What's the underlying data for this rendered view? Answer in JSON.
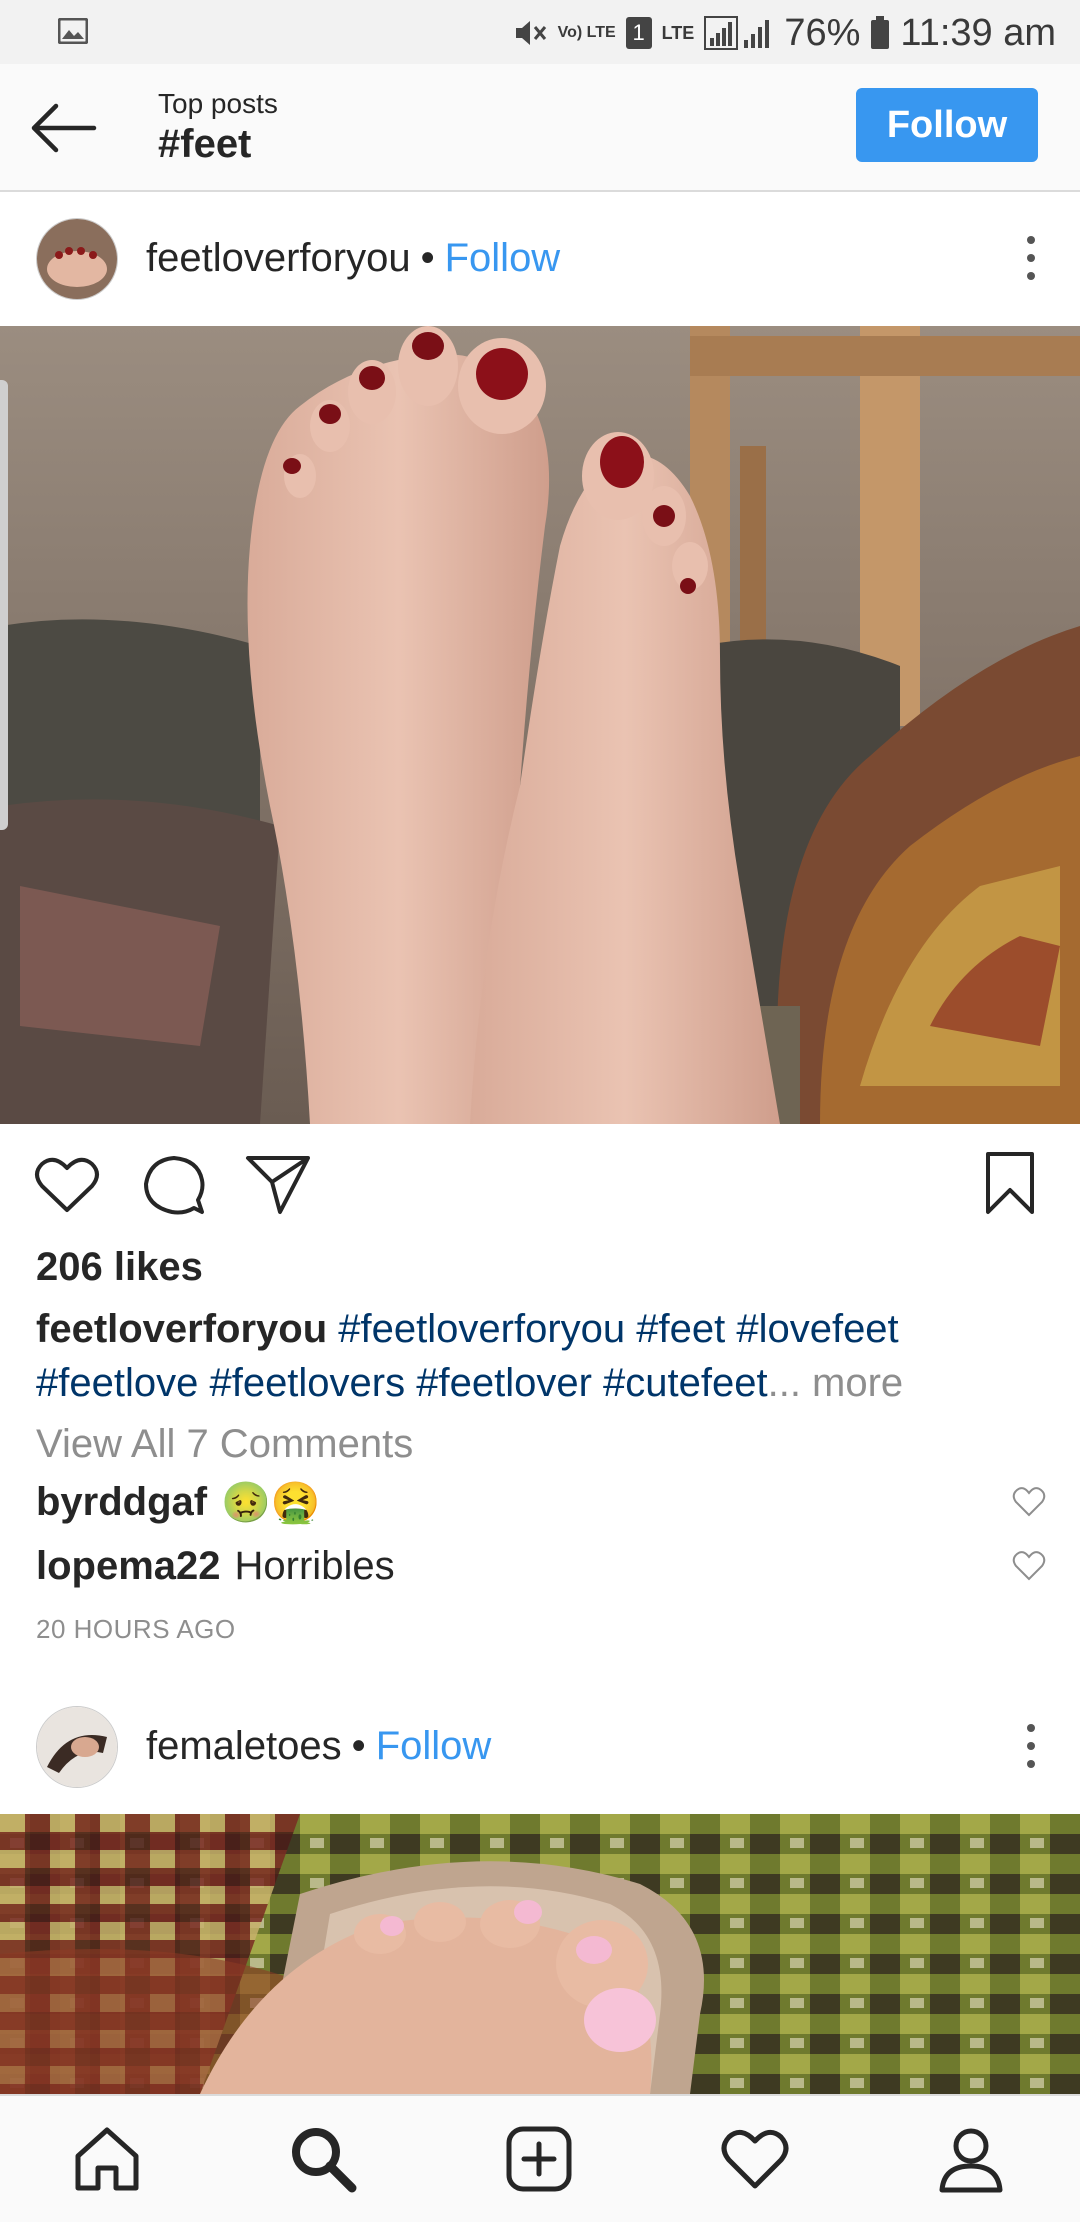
{
  "status_bar": {
    "battery": "76%",
    "time": "11:39 am",
    "network": "LTE",
    "volte": "Vo) LTE",
    "sim": "1"
  },
  "header": {
    "subtitle": "Top posts",
    "title": "#feet",
    "follow_label": "Follow",
    "accent_color": "#3897f0"
  },
  "posts": [
    {
      "username": "feetloverforyou",
      "separator": "•",
      "follow_label": "Follow",
      "likes": "206 likes",
      "caption_user": "feetloverforyou",
      "caption_tags_line1": "#feetloverforyou #feet #lovefeet",
      "caption_tags_line2": "#feetlove #feetlovers #feetlover #cutefeet",
      "caption_more": "... more",
      "view_comments": "View All 7 Comments",
      "comments": [
        {
          "user": "byrddgaf",
          "text": "🤢🤮"
        },
        {
          "user": "lopema22",
          "text": "Horribles"
        }
      ],
      "timestamp": "20 HOURS AGO"
    },
    {
      "username": "femaletoes",
      "separator": "•",
      "follow_label": "Follow"
    }
  ],
  "icons": {
    "back": "arrow-left-icon",
    "like": "heart-icon",
    "comment": "comment-icon",
    "share": "paper-plane-icon",
    "save": "bookmark-icon",
    "more": "vertical-dots-icon",
    "nav": [
      "home-icon",
      "search-icon",
      "add-icon",
      "activity-heart-icon",
      "profile-icon"
    ]
  }
}
